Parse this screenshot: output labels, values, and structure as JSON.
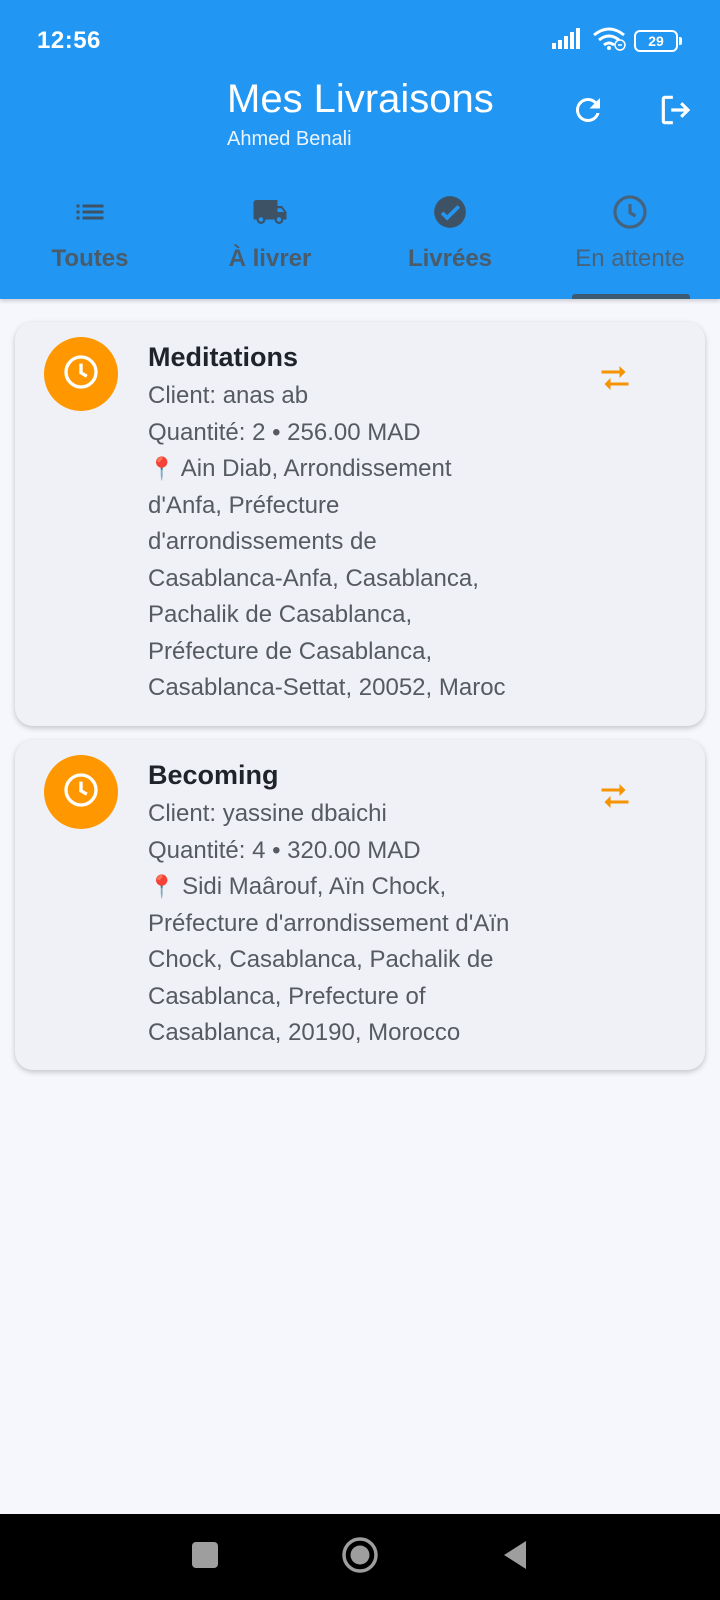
{
  "status_bar": {
    "time": "12:56",
    "battery": "29",
    "icons": [
      "signal-icon",
      "wifi-icon",
      "battery-icon"
    ]
  },
  "header": {
    "title": "Mes Livraisons",
    "subtitle": "Ahmed Benali",
    "actions": [
      "refresh-icon",
      "logout-icon"
    ],
    "background": "#2196f3"
  },
  "tabs": [
    {
      "label": "Toutes",
      "icon": "list-icon"
    },
    {
      "label": "À livrer",
      "icon": "truck-icon"
    },
    {
      "label": "Livrées",
      "icon": "check-circle-icon"
    },
    {
      "label": "En attente",
      "icon": "clock-icon",
      "selected": true
    }
  ],
  "deliveries": [
    {
      "title": "Meditations",
      "client": "Client: anas ab",
      "quantity": "Quantité: 2 • 256.00 MAD",
      "pin": "📍",
      "address_lines": [
        "Ain Diab, Arrondissement",
        "d'Anfa, Préfecture",
        "d'arrondissements de",
        "Casablanca-Anfa, Casablanca,",
        "Pachalik de Casablanca,",
        "Préfecture de Casablanca,",
        "Casablanca-Settat, 20052, Maroc"
      ],
      "status_icon": "clock-icon",
      "action_icon": "swap-icon"
    },
    {
      "title": "Becoming",
      "client": "Client: yassine dbaichi",
      "quantity": "Quantité: 4 • 320.00 MAD",
      "pin": "📍",
      "address_lines": [
        "Sidi Maârouf, Aïn Chock,",
        "Préfecture d'arrondissement d'Aïn",
        "Chock, Casablanca, Pachalik de",
        "Casablanca, Prefecture of",
        "Casablanca, 20190, Morocco"
      ],
      "status_icon": "clock-icon",
      "action_icon": "swap-icon"
    }
  ],
  "colors": {
    "accent": "#2196f3",
    "status_pending": "#ff9800",
    "card_background": "#f0f1f7",
    "page_background": "#f6f7fc"
  },
  "nav_bar": [
    "recents-square-icon",
    "home-circle-icon",
    "back-triangle-icon"
  ]
}
